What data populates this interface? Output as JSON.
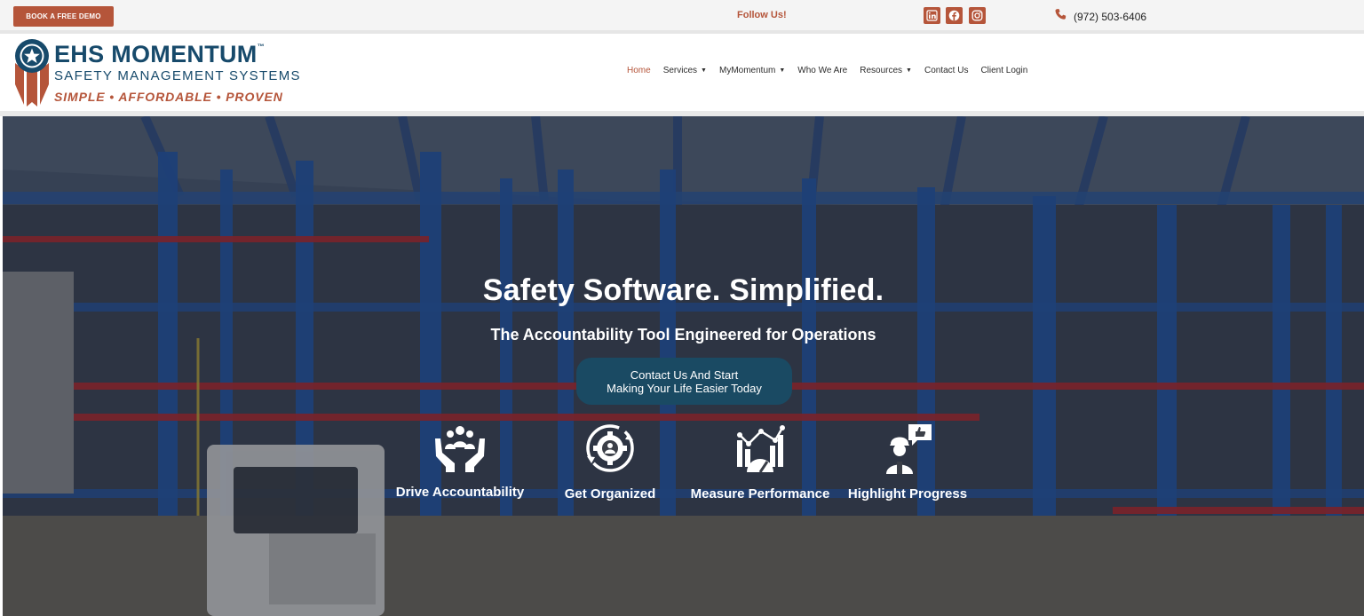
{
  "topbar": {
    "demo_button": "BOOK A FREE DEMO",
    "follow_label": "Follow Us!",
    "social_icons": [
      "linkedin-icon",
      "facebook-icon",
      "instagram-icon"
    ],
    "phone": "(972) 503-6406"
  },
  "logo": {
    "title": "EHS MOMENTUM",
    "trademark": "™",
    "subtitle": "SAFETY MANAGEMENT SYSTEMS",
    "tagline": "SIMPLE  •  AFFORDABLE  •  PROVEN"
  },
  "nav": {
    "items": [
      {
        "label": "Home",
        "active": true,
        "dropdown": false
      },
      {
        "label": "Services",
        "active": false,
        "dropdown": true
      },
      {
        "label": "MyMomentum",
        "active": false,
        "dropdown": true
      },
      {
        "label": "Who We Are",
        "active": false,
        "dropdown": false
      },
      {
        "label": "Resources",
        "active": false,
        "dropdown": true
      },
      {
        "label": "Contact Us",
        "active": false,
        "dropdown": false
      },
      {
        "label": "Client Login",
        "active": false,
        "dropdown": false
      }
    ],
    "caret": "▼"
  },
  "hero": {
    "title": "Safety Software. Simplified.",
    "subtitle": "The Accountability Tool Engineered for Operations",
    "cta_line1": "Contact Us And Start",
    "cta_line2": "Making Your Life Easier Today",
    "features": [
      {
        "label": "Drive Accountability",
        "icon": "hands-team-icon"
      },
      {
        "label": "Get Organized",
        "icon": "gear-cycle-icon"
      },
      {
        "label": "Measure Performance",
        "icon": "chart-gauge-icon"
      },
      {
        "label": "Highlight Progress",
        "icon": "worker-thumbs-up-icon"
      }
    ]
  },
  "colors": {
    "brand_navy": "#174a6b",
    "brand_rust": "#b5553a",
    "cta_bg": "#1a4a63"
  }
}
